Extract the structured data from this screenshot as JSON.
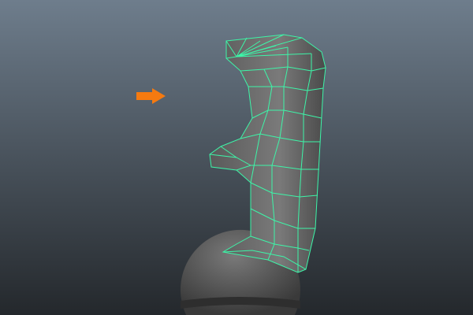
{
  "viewport": {
    "background_top": "#6e7d8c",
    "background_bottom": "#24282c",
    "wireframe_color": "#3df5a8",
    "mesh_color": "#6a6a6a",
    "pointer_arrow_color": "#f57a10"
  }
}
